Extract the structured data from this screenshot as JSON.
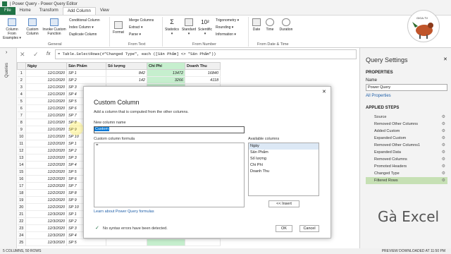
{
  "window": {
    "title": "| Power Query - Power Query Editor"
  },
  "tabs": [
    "File",
    "Home",
    "Transform",
    "Add Column",
    "View"
  ],
  "ribbon": {
    "general": {
      "label": "General",
      "buttons": [
        "Column From Examples ▾",
        "Custom Column",
        "Invoke Custom Function"
      ],
      "smalls": [
        "Conditional Column",
        "Index Column ▾",
        "Duplicate Column"
      ]
    },
    "from_text": {
      "label": "From Text",
      "format": "Format",
      "smalls": [
        "Merge Columns",
        "Extract ▾",
        "Parse ▾"
      ]
    },
    "from_number": {
      "label": "From Number",
      "buttons": [
        "Statistics ▾",
        "Standard ▾",
        "Scientific ▾"
      ],
      "smalls": [
        "Trigonometry ▾",
        "Rounding ▾",
        "Information ▾"
      ]
    },
    "from_datetime": {
      "label": "From Date & Time",
      "buttons": [
        "Date",
        "Time",
        "Duration"
      ]
    }
  },
  "left_panel": {
    "label": "Queries"
  },
  "formula": {
    "text": "= Table.SelectRows(#\"Changed Type\", each ([Sản Phẩm] <> \"Sản Phẩm\"))",
    "fx": "fx"
  },
  "grid": {
    "columns": [
      "Ngày",
      "Sản Phẩm",
      "Số lượng",
      "Chi Phí",
      "Doanh Thu"
    ],
    "rows": [
      [
        "1",
        "12/1/2020",
        "SP 1",
        "842",
        "13472",
        "16840"
      ],
      [
        "2",
        "12/1/2020",
        "SP 2",
        "142",
        "3266",
        "4118"
      ],
      [
        "3",
        "12/1/2020",
        "SP 3",
        "",
        "",
        ""
      ],
      [
        "4",
        "12/1/2020",
        "SP 4",
        "",
        "",
        ""
      ],
      [
        "5",
        "12/1/2020",
        "SP 5",
        "",
        "",
        ""
      ],
      [
        "6",
        "12/1/2020",
        "SP 6",
        "",
        "",
        ""
      ],
      [
        "7",
        "12/1/2020",
        "SP 7",
        "",
        "",
        ""
      ],
      [
        "8",
        "12/1/2020",
        "SP 8",
        "",
        "",
        ""
      ],
      [
        "9",
        "12/1/2020",
        "SP 9",
        "",
        "",
        ""
      ],
      [
        "10",
        "12/1/2020",
        "SP 10",
        "",
        "",
        ""
      ],
      [
        "11",
        "12/2/2020",
        "SP 1",
        "",
        "",
        ""
      ],
      [
        "12",
        "12/2/2020",
        "SP 2",
        "",
        "",
        ""
      ],
      [
        "13",
        "12/2/2020",
        "SP 3",
        "",
        "",
        ""
      ],
      [
        "14",
        "12/2/2020",
        "SP 4",
        "",
        "",
        ""
      ],
      [
        "15",
        "12/2/2020",
        "SP 5",
        "",
        "",
        ""
      ],
      [
        "16",
        "12/2/2020",
        "SP 6",
        "",
        "",
        ""
      ],
      [
        "17",
        "12/2/2020",
        "SP 7",
        "",
        "",
        ""
      ],
      [
        "18",
        "12/2/2020",
        "SP 8",
        "",
        "",
        ""
      ],
      [
        "19",
        "12/2/2020",
        "SP 9",
        "",
        "",
        ""
      ],
      [
        "20",
        "12/2/2020",
        "SP 10",
        "",
        "",
        ""
      ],
      [
        "21",
        "12/3/2020",
        "SP 1",
        "",
        "",
        ""
      ],
      [
        "22",
        "12/3/2020",
        "SP 2",
        "",
        "",
        ""
      ],
      [
        "23",
        "12/3/2020",
        "SP 3",
        "",
        "",
        ""
      ],
      [
        "24",
        "12/3/2020",
        "SP 4",
        "",
        "",
        ""
      ],
      [
        "25",
        "12/3/2020",
        "SP 5",
        "",
        "",
        ""
      ]
    ]
  },
  "query_settings": {
    "title": "Query Settings",
    "properties_h": "PROPERTIES",
    "name_label": "Name",
    "name_value": "Power Query",
    "all_props": "All Properties",
    "applied_h": "APPLIED STEPS",
    "steps": [
      "Source",
      "Removed Other Columns",
      "Added Custom",
      "Expanded Custom",
      "Removed Other Columns1",
      "Expanded Data",
      "Removed Columns",
      "Promoted Headers",
      "Changed Type",
      "Filtered Rows"
    ]
  },
  "status": {
    "left": "5 COLUMNS, 50 ROWS",
    "right": "PREVIEW DOWNLOADED AT 11:50 PM"
  },
  "dialog": {
    "title": "Custom Column",
    "desc": "Add a column that is computed from the other columns.",
    "name_label": "New column name",
    "name_value": "Custom",
    "formula_label": "Custom column formula",
    "formula_value": "=",
    "avail_label": "Available columns",
    "avail": [
      "Ngày",
      "Sản Phẩm",
      "Số lượng",
      "Chi Phí",
      "Doanh Thu"
    ],
    "insert": "<< Insert",
    "learn": "Learn about Power Query formulas",
    "status": "No syntax errors have been detected.",
    "ok": "OK",
    "cancel": "Cancel"
  },
  "logo": {
    "text": "GIGA.TV"
  },
  "watermark": "Gà Excel",
  "colors": {
    "excel_green": "#217346",
    "highlight": "#c6efce",
    "selected_step": "#c6e0b4"
  }
}
